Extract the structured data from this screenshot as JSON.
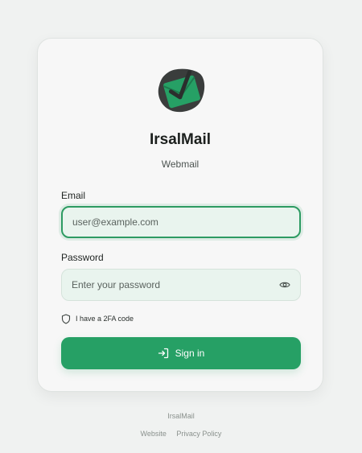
{
  "app": {
    "title": "IrsalMail",
    "subtitle": "Webmail"
  },
  "logo": {
    "icon": "envelope-check-icon",
    "blob_color": "#3a3d3c",
    "envelope_color": "#26a065"
  },
  "form": {
    "email": {
      "label": "Email",
      "placeholder": "user@example.com",
      "value": ""
    },
    "password": {
      "label": "Password",
      "placeholder": "Enter your password",
      "value": "",
      "toggle_icon": "eye-icon"
    },
    "twofa": {
      "label": "I have a 2FA code",
      "icon": "shield-icon"
    },
    "submit": {
      "label": "Sign in",
      "icon": "sign-in-icon"
    }
  },
  "footer": {
    "brand": "IrsalMail",
    "links": [
      {
        "label": "Website"
      },
      {
        "label": "Privacy Policy"
      }
    ]
  },
  "colors": {
    "accent": "#26a065",
    "page_background": "#f0f2f1",
    "card_background": "#f7f7f7",
    "input_background": "#e9f4ee"
  }
}
